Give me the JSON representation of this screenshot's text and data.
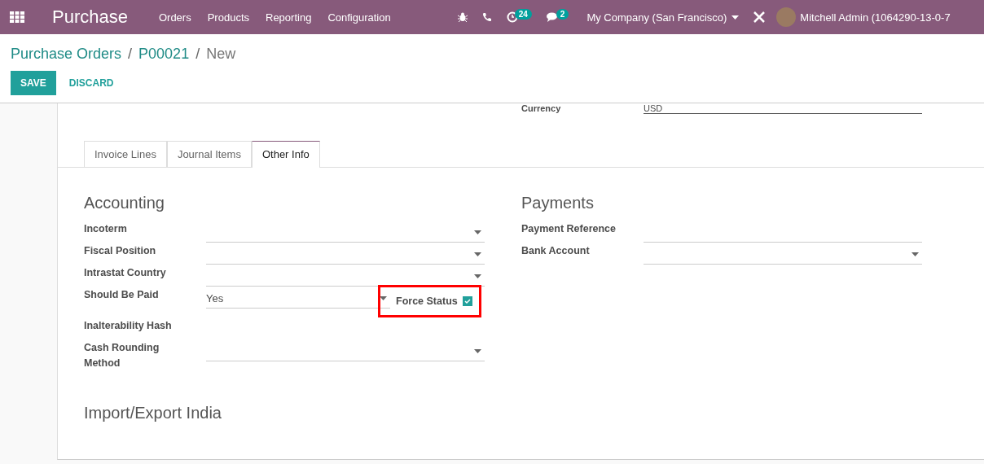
{
  "navbar": {
    "app_name": "Purchase",
    "menu": [
      "Orders",
      "Products",
      "Reporting",
      "Configuration"
    ],
    "activity_count": "24",
    "message_count": "2",
    "company": "My Company (San Francisco)",
    "user": "Mitchell Admin (1064290-13-0-7"
  },
  "breadcrumbs": [
    "Purchase Orders",
    "P00021",
    "New"
  ],
  "breadcrumb_separator": "/",
  "buttons": {
    "save": "SAVE",
    "discard": "DISCARD"
  },
  "currency": {
    "label": "Currency",
    "value": "USD"
  },
  "tabs": [
    {
      "label": "Invoice Lines",
      "selected": false
    },
    {
      "label": "Journal Items",
      "selected": false
    },
    {
      "label": "Other Info",
      "selected": true
    }
  ],
  "accounting": {
    "title": "Accounting",
    "fields": [
      {
        "label": "Incoterm",
        "kind": "select"
      },
      {
        "label": "Fiscal Position",
        "kind": "select"
      },
      {
        "label": "Intrastat Country",
        "kind": "select"
      },
      {
        "label": "Should Be Paid",
        "kind": "select",
        "value": "Yes",
        "force_status": {
          "label": "Force Status",
          "checked": true,
          "highlighted": true
        }
      },
      {
        "label": "Inalterability Hash",
        "kind": "readonly"
      },
      {
        "label": "Cash Rounding Method",
        "kind": "select"
      }
    ]
  },
  "payments": {
    "title": "Payments",
    "fields": [
      {
        "label": "Payment Reference",
        "kind": "text"
      },
      {
        "label": "Bank Account",
        "kind": "select"
      }
    ]
  },
  "section_title": "Import/Export India"
}
